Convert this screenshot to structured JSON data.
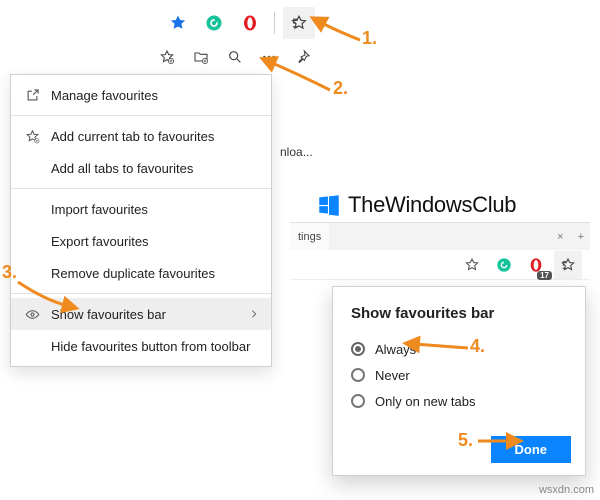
{
  "annotations": {
    "one": "1.",
    "two": "2.",
    "three": "3.",
    "four": "4.",
    "five": "5."
  },
  "menu": {
    "manage": "Manage favourites",
    "add_current": "Add current tab to favourites",
    "add_all": "Add all tabs to favourites",
    "import": "Import favourites",
    "export": "Export favourites",
    "remove_dup": "Remove duplicate favourites",
    "show_bar": "Show favourites bar",
    "hide_button": "Hide favourites button from toolbar"
  },
  "dialog": {
    "title": "Show favourites bar",
    "opt_always": "Always",
    "opt_never": "Never",
    "opt_new_tabs": "Only on new tabs",
    "done": "Done"
  },
  "brand": {
    "text": "TheWindowsClub"
  },
  "right_window": {
    "tab_label": "tings",
    "badge": "17"
  },
  "snippets": {
    "nloa": "nloa..."
  },
  "watermark": "wsxdn.com",
  "colors": {
    "accent": "#0a84ff",
    "anno": "#ef8a1f"
  }
}
